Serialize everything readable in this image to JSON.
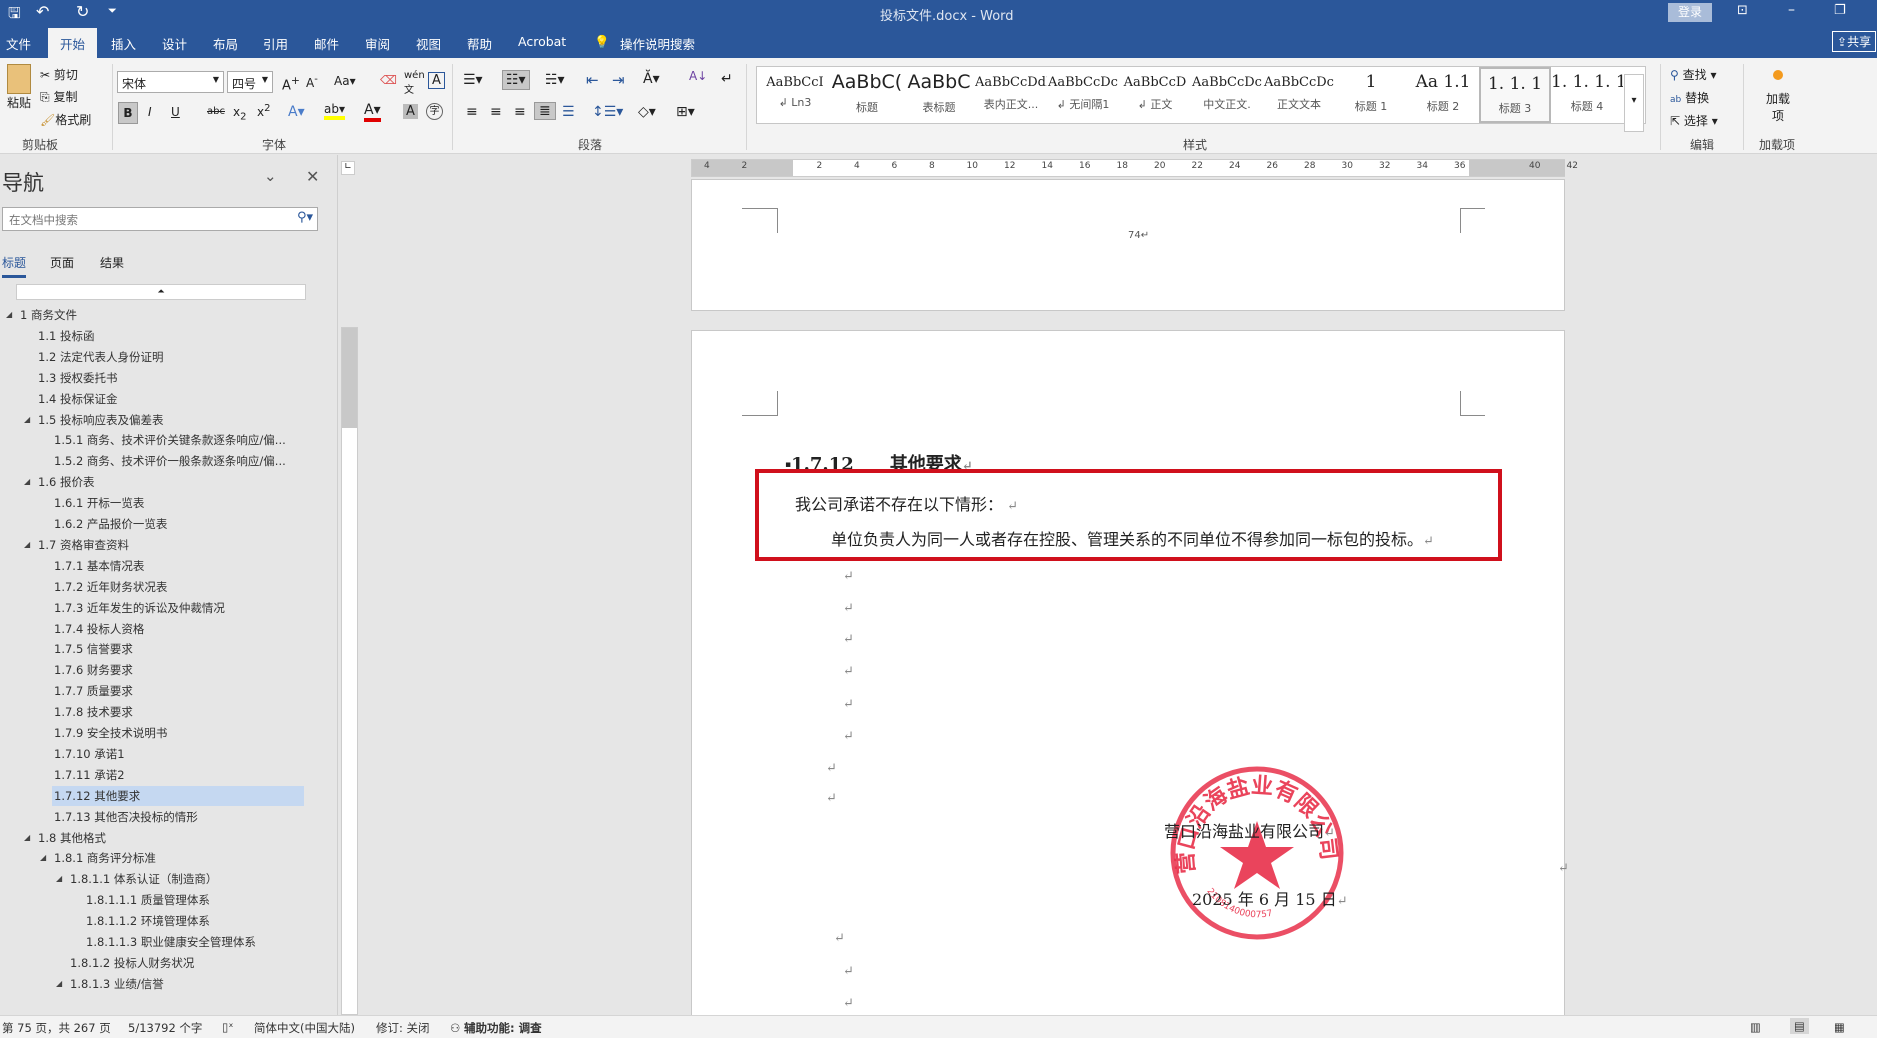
{
  "titlebar": {
    "doc_title": "投标文件.docx  -  Word",
    "login": "登录",
    "share": "共享"
  },
  "tabs": [
    "文件",
    "开始",
    "插入",
    "设计",
    "布局",
    "引用",
    "邮件",
    "审阅",
    "视图",
    "帮助",
    "Acrobat"
  ],
  "tell_me": "操作说明搜索",
  "ribbon": {
    "clipboard": {
      "paste": "粘贴",
      "cut": "剪切",
      "copy": "复制",
      "format_painter": "格式刷",
      "label": "剪贴板"
    },
    "font": {
      "font_name": "宋体",
      "font_size": "四号",
      "label": "字体",
      "bold": "B",
      "italic": "I",
      "underline": "U",
      "highlight_color": "#ffff00",
      "font_color": "#e00000"
    },
    "paragraph": {
      "label": "段落"
    },
    "styles": {
      "label": "样式",
      "items": [
        {
          "preview": "AaBbCcI",
          "name": "↲ Ln3"
        },
        {
          "preview": "AaBbC(",
          "name": "标题"
        },
        {
          "preview": "AaBbC",
          "name": "表标题"
        },
        {
          "preview": "AaBbCcDdI",
          "name": "表内正文..."
        },
        {
          "preview": "AaBbCcDc",
          "name": "↲ 无间隔1"
        },
        {
          "preview": "AaBbCcD",
          "name": "↲ 正文"
        },
        {
          "preview": "AaBbCcDc",
          "name": "中文正文."
        },
        {
          "preview": "AaBbCcDc",
          "name": "正文文本"
        },
        {
          "preview": "1",
          "name": "标题 1"
        },
        {
          "preview": "Aa  1.1",
          "name": "标题 2"
        },
        {
          "preview": "1. 1. 1",
          "name": "标题 3"
        },
        {
          "preview": "1. 1. 1. 1",
          "name": "标题 4"
        }
      ],
      "selected_index": 10
    },
    "editing": {
      "find": "查找",
      "replace": "替换",
      "select": "选择",
      "label": "编辑"
    },
    "addins": {
      "button": "加载项",
      "label": "加载项"
    }
  },
  "nav": {
    "title": "导航",
    "search_placeholder": "在文档中搜索",
    "tabs": [
      "标题",
      "页面",
      "结果"
    ],
    "items": [
      {
        "text": "1 商务文件",
        "level": 1,
        "expanded": true
      },
      {
        "text": "1.1 投标函",
        "level": 2
      },
      {
        "text": "1.2 法定代表人身份证明",
        "level": 2
      },
      {
        "text": "1.3 授权委托书",
        "level": 2
      },
      {
        "text": "1.4 投标保证金",
        "level": 2
      },
      {
        "text": "1.5 投标响应表及偏差表",
        "level": 2,
        "expanded": true
      },
      {
        "text": "1.5.1 商务、技术评价关键条款逐条响应/偏...",
        "level": 3
      },
      {
        "text": "1.5.2 商务、技术评价一般条款逐条响应/偏...",
        "level": 3
      },
      {
        "text": "1.6 报价表",
        "level": 2,
        "expanded": true
      },
      {
        "text": "1.6.1 开标一览表",
        "level": 3
      },
      {
        "text": "1.6.2 产品报价一览表",
        "level": 3
      },
      {
        "text": "1.7 资格审查资料",
        "level": 2,
        "expanded": true
      },
      {
        "text": "1.7.1 基本情况表",
        "level": 3
      },
      {
        "text": "1.7.2 近年财务状况表",
        "level": 3
      },
      {
        "text": "1.7.3 近年发生的诉讼及仲裁情况",
        "level": 3
      },
      {
        "text": "1.7.4 投标人资格",
        "level": 3
      },
      {
        "text": "1.7.5 信誉要求",
        "level": 3
      },
      {
        "text": "1.7.6 财务要求",
        "level": 3
      },
      {
        "text": "1.7.7 质量要求",
        "level": 3
      },
      {
        "text": "1.7.8 技术要求",
        "level": 3
      },
      {
        "text": "1.7.9 安全技术说明书",
        "level": 3
      },
      {
        "text": "1.7.10 承诺1",
        "level": 3
      },
      {
        "text": "1.7.11 承诺2",
        "level": 3
      },
      {
        "text": "1.7.12 其他要求",
        "level": 3,
        "selected": true
      },
      {
        "text": "1.7.13 其他否决投标的情形",
        "level": 3
      },
      {
        "text": "1.8 其他格式",
        "level": 2,
        "expanded": true
      },
      {
        "text": "1.8.1 商务评分标准",
        "level": 3,
        "expanded": true
      },
      {
        "text": "1.8.1.1 体系认证（制造商）",
        "level": 4,
        "expanded": true
      },
      {
        "text": "1.8.1.1.1 质量管理体系",
        "level": 5
      },
      {
        "text": "1.8.1.1.2 环境管理体系",
        "level": 5
      },
      {
        "text": "1.8.1.1.3 职业健康安全管理体系",
        "level": 5
      },
      {
        "text": "1.8.1.2 投标人财务状况",
        "level": 4
      },
      {
        "text": "1.8.1.3 业绩/信誉",
        "level": 4,
        "expanded": true
      }
    ]
  },
  "ruler": {
    "ticks": [
      "4",
      "2",
      "",
      "2",
      "4",
      "6",
      "8",
      "10",
      "12",
      "14",
      "16",
      "18",
      "20",
      "22",
      "24",
      "26",
      "28",
      "30",
      "32",
      "34",
      "36",
      "",
      "40",
      "42"
    ]
  },
  "document": {
    "prev_page_number": "74",
    "heading": "1.7.12　　其他要求",
    "line1": "我公司承诺不存在以下情形：",
    "line2": "单位负责人为同一人或者存在控股、管理关系的不同单位不得参加同一标包的投标。",
    "company": "营口沿海盐业有限公司",
    "date": "2025 年 6 月 15 日",
    "seal_text": "营口沿海盐业有限公司",
    "seal_number": "2108140000757",
    "highlight_color": "#d0101c",
    "seal_color": "#e8304a"
  },
  "status": {
    "page": "第 75 页，共 267 页",
    "words": "5/13792 个字",
    "language": "简体中文(中国大陆)",
    "track": "修订: 关闭",
    "accessibility": "辅助功能: 调查"
  }
}
